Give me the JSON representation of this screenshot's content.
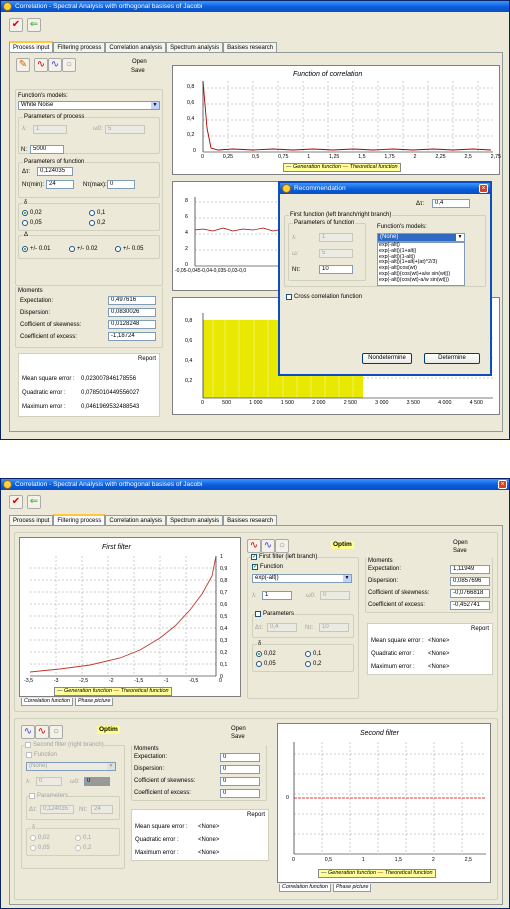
{
  "app_title": "Correlation - Spectral Analysis with orthogonal basises of Jacobi",
  "close_glyph": "×",
  "tabs": [
    "Process input",
    "Filtering process",
    "Correlation analysis",
    "Spectrum analysis",
    "Basises research"
  ],
  "open_label": "Open",
  "save_label": "Save",
  "w1": {
    "functions_models_label": "Function's models:",
    "function_model": "White Noise",
    "params_process_title": "Parameters of process",
    "lambda_label": "λ:",
    "lambda_value": "1",
    "omega0_label": "ω0:",
    "omega0_value": "5",
    "n_label": "N:",
    "n_value": "5000",
    "params_function_title": "Parameters of function",
    "dtau_label": "Δτ:",
    "dtau_value": "0,124035",
    "nmin_label": "Nτ(min):",
    "nmin_value": "24",
    "nmax_label": "Nτ(max):",
    "nmax_value": "0",
    "delta_title": "δ",
    "delta_opts": [
      "0,02",
      "0,1",
      "0,05",
      "0,2"
    ],
    "Delta_title": "Δ",
    "Delta_opts": [
      "+/- 0.01",
      "+/- 0.02",
      "+/- 0.05"
    ],
    "moments_title": "Moments",
    "moments": [
      [
        "Expectation:",
        "0,497616"
      ],
      [
        "Dispersion:",
        "0,0830026"
      ],
      [
        "Cofficient of skewness:",
        "0,0128248"
      ],
      [
        "Coefficient of excess:",
        "-1,18724"
      ]
    ],
    "report_title": "Report",
    "report": [
      [
        "Mean square error :",
        "0,023007846178556"
      ],
      [
        "Quadratic error :",
        "0,0785010449556027"
      ],
      [
        "Maximum error :",
        "0,0461969532488543"
      ]
    ],
    "chart1": {
      "title": "Function of correlation",
      "yticks": [
        "0,8",
        "0,6",
        "0,4",
        "0,2",
        "0"
      ],
      "xticks": [
        "0",
        "0,25",
        "0,5",
        "0,75",
        "1",
        "1,25",
        "1,5",
        "1,75",
        "2",
        "2,25",
        "2,5",
        "2,75"
      ],
      "legend_gen": "Generation function",
      "legend_theo": "Theoretical function"
    },
    "chart2": {
      "yticks": [
        "8",
        "6",
        "4",
        "2",
        "0"
      ],
      "xticks": "-0,05-0,045-0,04-0,035-0,03-0,0"
    },
    "chart3": {
      "yticks": [
        "0,8",
        "0,6",
        "0,4",
        "0,2"
      ],
      "xticks": [
        "0",
        "500",
        "1 000",
        "1 500",
        "2 000",
        "2 500",
        "3 000",
        "3 500",
        "4 000",
        "4 500"
      ]
    },
    "dialog": {
      "title": "Recommendation",
      "dtau_label": "Δτ:",
      "dtau_value": "0,4",
      "first_function_title": "First function (left branch/right branch)",
      "params_title": "Parameters of function",
      "lambda_label": "λ:",
      "lambda_value": "1",
      "omega_label": "ω:",
      "omega_value": "5",
      "ntau_label": "Nτ:",
      "ntau_value": "10",
      "models_label": "Function's models:",
      "model_value": "(None)",
      "model_options": [
        "exp(-alt|)",
        "exp(-alt|)(1+alt|)",
        "exp(-alt|)(1-alt|)",
        "exp(-alt|)(1+alt|+(at)^2/3)",
        "exp(-alt|)cos(wt)",
        "exp(-alt|)(cos(wt)+a/w sin(wt|))",
        "exp(-alt|)(cos(wt)-a/w sin(wt|))"
      ],
      "cross_label": "Cross correlation function",
      "nondetermine": "Nondetermine",
      "determine": "Determine"
    }
  },
  "w2": {
    "optim_label": "Optim",
    "first_filter": {
      "title": "First filter",
      "yticks": [
        "1",
        "0,9",
        "0,8",
        "0,7",
        "0,6",
        "0,5",
        "0,4",
        "0,3",
        "0,2",
        "0,1",
        "0"
      ],
      "xticks": [
        "-3,5",
        "-3",
        "-2,5",
        "-2",
        "-1,5",
        "-1",
        "-0,5",
        "0"
      ],
      "legend_gen": "Generation function",
      "legend_theo": "Theoretical function",
      "tabs": [
        "Correlation function",
        "Phase picture"
      ]
    },
    "ff_group": "First filter (left branch)",
    "function_chk": "Function",
    "function_value": "exp(-alt|)",
    "lambda_label": "λ:",
    "lambda_value": "1",
    "omega0_label": "ω0:",
    "omega0_value": "0",
    "params_chk": "Parameters",
    "dtau_label": "Δτ:",
    "dtau_value": "0,4",
    "ntau_label": "Nτ:",
    "ntau_value": "10",
    "delta_title": "δ",
    "delta_opts": [
      "0,02",
      "0,1",
      "0,05",
      "0,2"
    ],
    "moments_title": "Moments",
    "moments": [
      [
        "Expectation:",
        "1,11949"
      ],
      [
        "Dispersion:",
        "0,0857696"
      ],
      [
        "Cofficient of skewness:",
        "-0,0766818"
      ],
      [
        "Coefficient of excess:",
        "-0,452741"
      ]
    ],
    "report_title": "Report",
    "report": [
      [
        "Mean square error :",
        "<None>"
      ],
      [
        "Quadratic error :",
        "<None>"
      ],
      [
        "Maximum error :",
        "<None>"
      ]
    ],
    "sf_group": "Second filter (right branch)",
    "sf_function_value": "(None)",
    "sf_lambda_value": "0",
    "sf_omega_value": "0",
    "sf_dtau_value": "0,124035",
    "sf_ntau_value": "24",
    "moments2": [
      [
        "Expectation:",
        "0"
      ],
      [
        "Dispersion:",
        "0"
      ],
      [
        "Cofficient of skewness:",
        "0"
      ],
      [
        "Coefficient of excess:",
        "0"
      ]
    ],
    "report2": [
      [
        "Mean square error :",
        "<None>"
      ],
      [
        "Quadratic error :",
        "<None>"
      ],
      [
        "Maximum error :",
        "<None>"
      ]
    ],
    "second_filter": {
      "title": "Second filter",
      "yticks": [
        "0"
      ],
      "xticks": [
        "0",
        "0,5",
        "1",
        "1,5",
        "2",
        "2,5"
      ],
      "legend_gen": "Generation function",
      "legend_theo": "Theoretical function",
      "tabs": [
        "Correlation function",
        "Phase picture"
      ]
    }
  }
}
